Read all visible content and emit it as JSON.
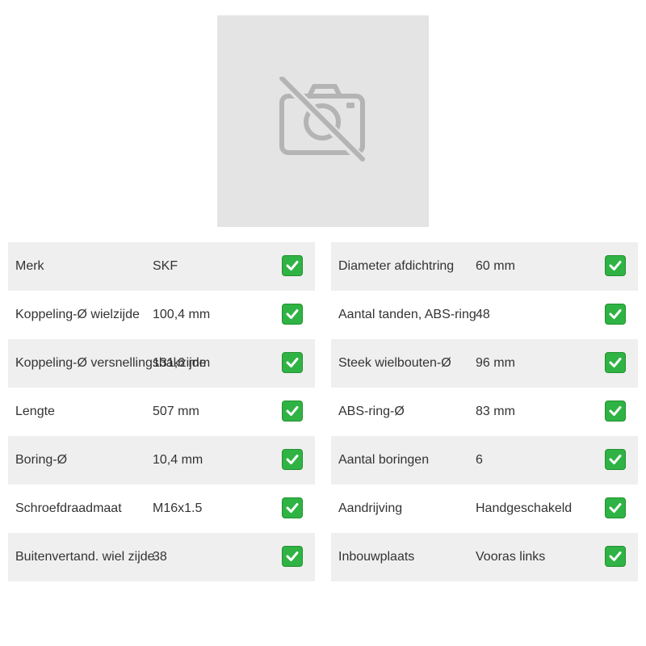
{
  "product_image": {
    "icon": "no-photo-camera-icon"
  },
  "specs_left": [
    {
      "label": "Merk",
      "value": "SKF",
      "icon": "check-icon"
    },
    {
      "label": "Koppeling-Ø wielzijde",
      "value": "100,4 mm",
      "icon": "check-icon"
    },
    {
      "label": "Koppeling-Ø versnellingsbakzijde",
      "value": "131,6 mm",
      "icon": "check-icon"
    },
    {
      "label": "Lengte",
      "value": "507 mm",
      "icon": "check-icon"
    },
    {
      "label": "Boring-Ø",
      "value": "10,4 mm",
      "icon": "check-icon"
    },
    {
      "label": "Schroefdraadmaat",
      "value": "M16x1.5",
      "icon": "check-icon"
    },
    {
      "label": "Buitenvertand. wiel zijde",
      "value": "38",
      "icon": "check-icon"
    }
  ],
  "specs_right": [
    {
      "label": "Diameter afdichtring",
      "value": "60 mm",
      "icon": "check-icon"
    },
    {
      "label": "Aantal tanden, ABS-ring",
      "value": "48",
      "icon": "check-icon"
    },
    {
      "label": "Steek wielbouten-Ø",
      "value": "96 mm",
      "icon": "check-icon"
    },
    {
      "label": "ABS-ring-Ø",
      "value": "83 mm",
      "icon": "check-icon"
    },
    {
      "label": "Aantal boringen",
      "value": "6",
      "icon": "check-icon"
    },
    {
      "label": "Aandrijving",
      "value": "Handgeschakeld",
      "icon": "check-icon"
    },
    {
      "label": "Inbouwplaats",
      "value": "Vooras links",
      "icon": "check-icon"
    }
  ],
  "colors": {
    "row_shaded": "#efefef",
    "placeholder_bg": "#e4e4e4",
    "check_green": "#2fb344",
    "text": "#333333"
  }
}
